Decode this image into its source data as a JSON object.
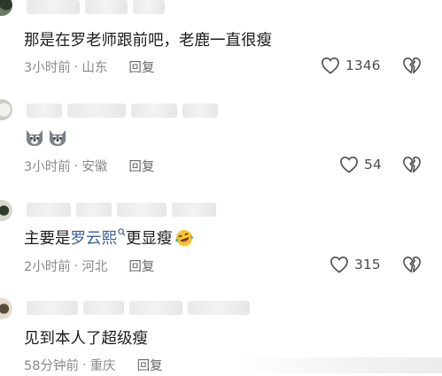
{
  "comments": [
    {
      "text": "那是在罗老师跟前吧，老鹿一直很瘦",
      "time": "3小时前",
      "sep": "·",
      "location": "山东",
      "reply": "回复",
      "likes": "1346"
    },
    {
      "emoji": [
        "husky-emoji",
        "husky-emoji"
      ],
      "time": "3小时前",
      "sep": "·",
      "location": "安徽",
      "reply": "回复",
      "likes": "54"
    },
    {
      "text_prefix": "主要是",
      "mention": "罗云熙",
      "text_suffix": "更显瘦",
      "emoji": "laugh-cry-emoji",
      "time": "2小时前",
      "sep": "·",
      "location": "河北",
      "reply": "回复",
      "likes": "315"
    },
    {
      "text": "见到本人了超级瘦",
      "time": "58分钟前",
      "sep": "·",
      "location": "重庆",
      "reply": "回复"
    }
  ],
  "colors": {
    "text": "#1c1c1c",
    "meta": "#8a8a8a",
    "mention": "#3a5d96"
  }
}
